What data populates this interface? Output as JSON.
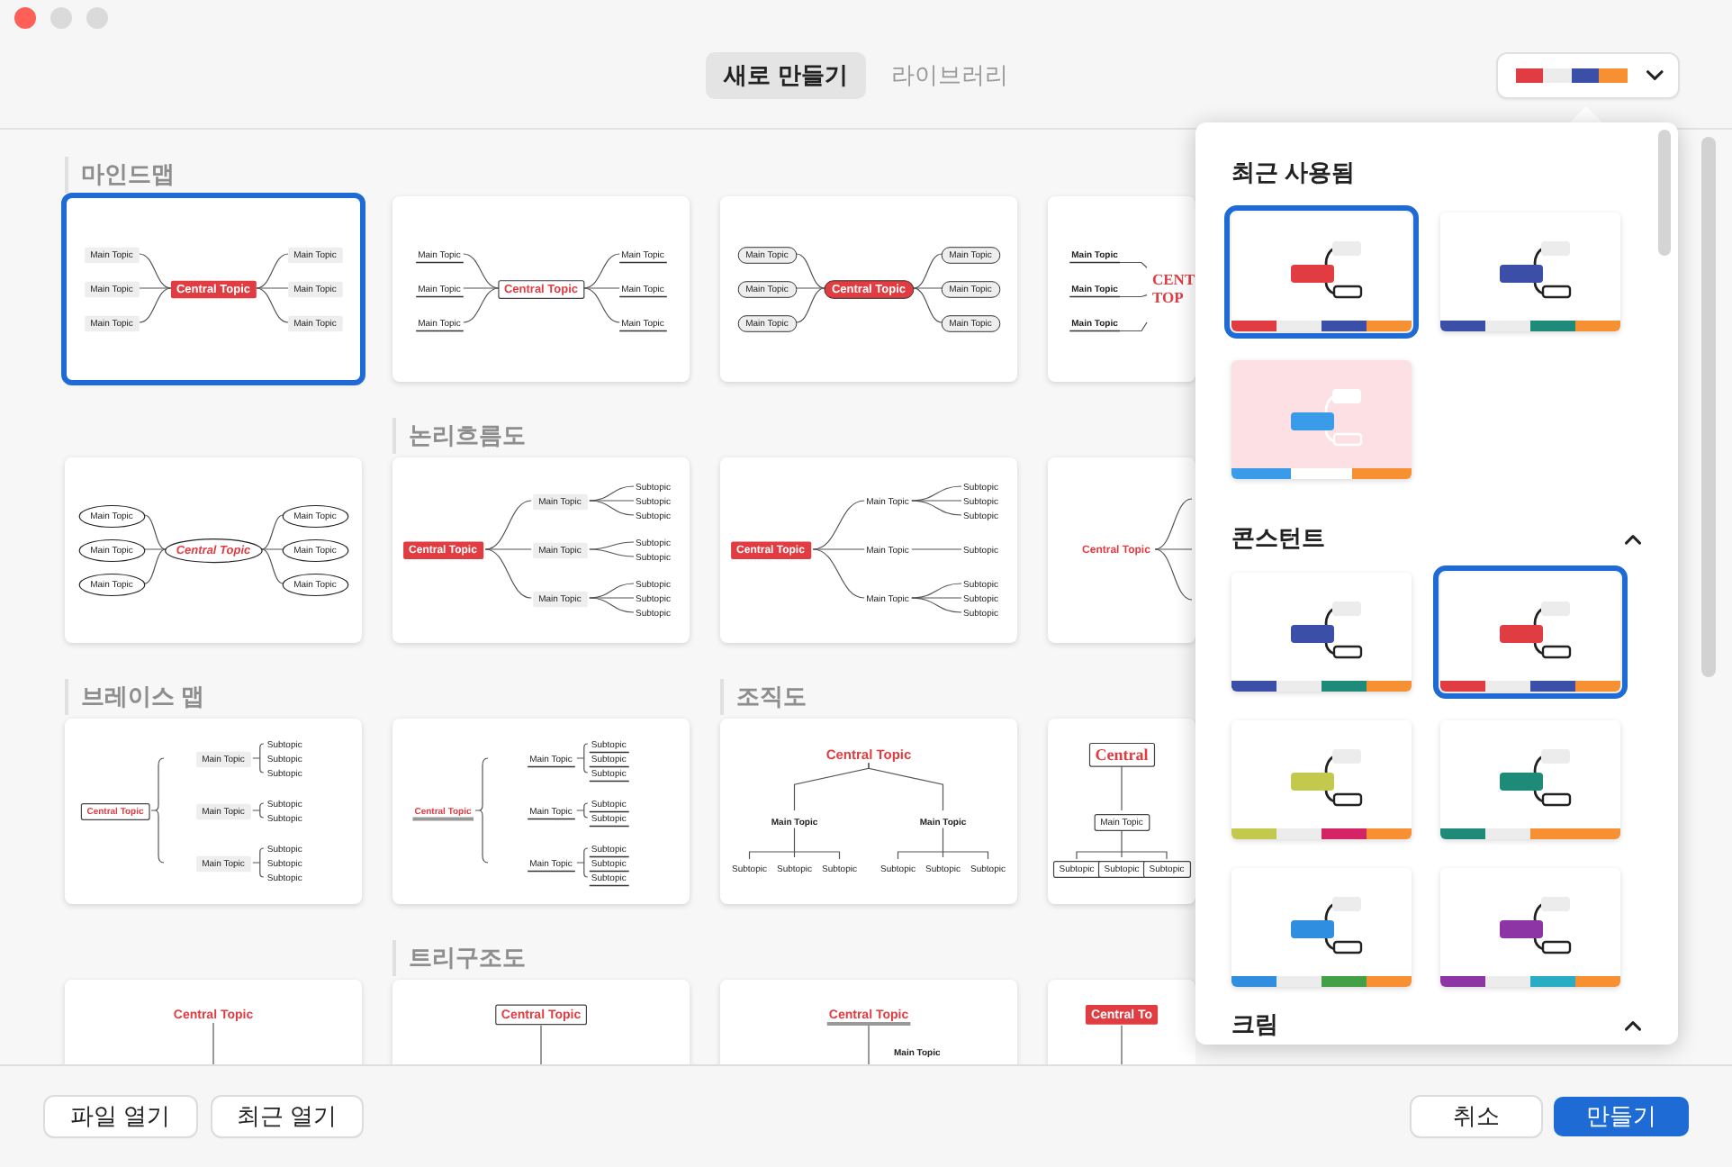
{
  "window": {
    "tabs": [
      {
        "label": "새로 만들기",
        "selected": true
      },
      {
        "label": "라이브러리",
        "selected": false
      }
    ],
    "theme_button": {
      "colors": [
        {
          "color": "#e03c41"
        },
        {
          "color": "#ececec"
        },
        {
          "color": "#3b4fa8"
        },
        {
          "color": "#f78f33"
        }
      ]
    }
  },
  "templates": [
    {
      "section": "마인드맵",
      "selected": true,
      "diagram": {
        "kind": "mindmap",
        "central": {
          "label": "Central Topic",
          "kind": "filled"
        },
        "branches": [
          {
            "label": "Main Topic",
            "kind": "filled"
          },
          {
            "label": "Main Topic",
            "kind": "filled"
          },
          {
            "label": "Main Topic",
            "kind": "filled"
          },
          {
            "label": "Main Topic",
            "kind": "filled"
          },
          {
            "label": "Main Topic",
            "kind": "filled"
          },
          {
            "label": "Main Topic",
            "kind": "filled"
          }
        ]
      }
    },
    {
      "selected": false,
      "diagram": {
        "kind": "mindmap",
        "central": {
          "label": "Central Topic",
          "kind": "outline"
        },
        "branches": [
          {
            "label": "Main Topic",
            "kind": "underline"
          },
          {
            "label": "Main Topic",
            "kind": "underline"
          },
          {
            "label": "Main Topic",
            "kind": "underline"
          },
          {
            "label": "Main Topic",
            "kind": "underline"
          },
          {
            "label": "Main Topic",
            "kind": "underline"
          },
          {
            "label": "Main Topic",
            "kind": "underline"
          }
        ]
      }
    },
    {
      "selected": false,
      "diagram": {
        "kind": "mindmap",
        "central": {
          "label": "Central Topic",
          "kind": "pill"
        },
        "branches": [
          {
            "label": "Main Topic",
            "kind": "pill"
          },
          {
            "label": "Main Topic",
            "kind": "pill"
          },
          {
            "label": "Main Topic",
            "kind": "pill"
          },
          {
            "label": "Main Topic",
            "kind": "pill"
          },
          {
            "label": "Main Topic",
            "kind": "pill"
          },
          {
            "label": "Main Topic",
            "kind": "pill"
          }
        ]
      }
    },
    {
      "selected": false,
      "diagram": {
        "kind": "map-left",
        "central": {
          "label": [
            "CENT",
            "TOP"
          ],
          "kind": "plain"
        },
        "branches": [
          {
            "label": "Main Topic",
            "kind": "underline"
          },
          {
            "label": "Main Topic",
            "kind": "underline"
          },
          {
            "label": "Main Topic",
            "kind": "underline"
          }
        ]
      }
    },
    {
      "selected": false,
      "diagram": {
        "kind": "mindmap",
        "central": {
          "label": "Central Topic",
          "kind": "ellipse"
        },
        "branches": [
          {
            "label": "Main Topic",
            "kind": "ellipse"
          },
          {
            "label": "Main Topic",
            "kind": "ellipse"
          },
          {
            "label": "Main Topic",
            "kind": "ellipse"
          },
          {
            "label": "Main Topic",
            "kind": "ellipse"
          },
          {
            "label": "Main Topic",
            "kind": "ellipse"
          },
          {
            "label": "Main Topic",
            "kind": "ellipse"
          }
        ]
      }
    },
    {
      "section": "논리흐름도",
      "selected": false,
      "diagram": {
        "kind": "logic",
        "central": {
          "label": "Central Topic",
          "kind": "filled"
        },
        "branches": [
          {
            "label": "Main Topic",
            "kind": "filled",
            "subtopics": [
              {
                "label": "Subtopic",
                "kind": "plain"
              },
              {
                "label": "Subtopic",
                "kind": "plain"
              },
              {
                "label": "Subtopic",
                "kind": "plain"
              }
            ]
          },
          {
            "label": "Main Topic",
            "kind": "filled",
            "subtopics": [
              {
                "label": "Subtopic",
                "kind": "plain"
              },
              {
                "label": "Subtopic",
                "kind": "plain"
              }
            ]
          },
          {
            "label": "Main Topic",
            "kind": "filled",
            "subtopics": [
              {
                "label": "Subtopic",
                "kind": "plain"
              },
              {
                "label": "Subtopic",
                "kind": "plain"
              },
              {
                "label": "Subtopic",
                "kind": "plain"
              }
            ]
          }
        ]
      }
    },
    {
      "selected": false,
      "diagram": {
        "kind": "logic",
        "central": {
          "label": "Central Topic",
          "kind": "filled"
        },
        "branches": [
          {
            "label": "Main Topic",
            "kind": "plain",
            "subtopics": [
              {
                "label": "Subtopic",
                "kind": "plain"
              },
              {
                "label": "Subtopic",
                "kind": "plain"
              },
              {
                "label": "Subtopic",
                "kind": "plain"
              }
            ]
          },
          {
            "label": "Main Topic",
            "kind": "plain",
            "subtopics": [
              {
                "label": "Subtopic",
                "kind": "plain"
              }
            ]
          },
          {
            "label": "Main Topic",
            "kind": "plain",
            "subtopics": [
              {
                "label": "Subtopic",
                "kind": "plain"
              },
              {
                "label": "Subtopic",
                "kind": "plain"
              },
              {
                "label": "Subtopic",
                "kind": "plain"
              }
            ]
          }
        ]
      }
    },
    {
      "selected": false,
      "diagram": {
        "kind": "logic",
        "central": {
          "label": "Central Topic",
          "kind": "plain"
        }
      }
    },
    {
      "section": "브레이스 맵",
      "selected": false,
      "diagram": {
        "kind": "brace",
        "central": {
          "label": "Central Topic",
          "kind": "outline"
        },
        "branches": [
          {
            "label": "Main Topic",
            "kind": "filled",
            "subtopics": [
              {
                "label": "Subtopic",
                "kind": "plain"
              },
              {
                "label": "Subtopic",
                "kind": "plain"
              },
              {
                "label": "Subtopic",
                "kind": "plain"
              }
            ]
          },
          {
            "label": "Main Topic",
            "kind": "filled",
            "subtopics": [
              {
                "label": "Subtopic",
                "kind": "plain"
              },
              {
                "label": "Subtopic",
                "kind": "plain"
              }
            ]
          },
          {
            "label": "Main Topic",
            "kind": "filled",
            "subtopics": [
              {
                "label": "Subtopic",
                "kind": "plain"
              },
              {
                "label": "Subtopic",
                "kind": "plain"
              },
              {
                "label": "Subtopic",
                "kind": "plain"
              }
            ]
          }
        ]
      }
    },
    {
      "selected": false,
      "diagram": {
        "kind": "brace",
        "central": {
          "label": "Central Topic",
          "kind": "underline"
        },
        "branches": [
          {
            "label": "Main Topic",
            "kind": "underline",
            "subtopics": [
              {
                "label": "Subtopic",
                "kind": "underline"
              },
              {
                "label": "Subtopic",
                "kind": "underline"
              },
              {
                "label": "Subtopic",
                "kind": "underline"
              }
            ]
          },
          {
            "label": "Main Topic",
            "kind": "underline",
            "subtopics": [
              {
                "label": "Subtopic",
                "kind": "underline"
              },
              {
                "label": "Subtopic",
                "kind": "underline"
              }
            ]
          },
          {
            "label": "Main Topic",
            "kind": "underline",
            "subtopics": [
              {
                "label": "Subtopic",
                "kind": "underline"
              },
              {
                "label": "Subtopic",
                "kind": "underline"
              },
              {
                "label": "Subtopic",
                "kind": "underline"
              }
            ]
          }
        ]
      }
    },
    {
      "section": "조직도",
      "selected": false,
      "diagram": {
        "kind": "org",
        "central": {
          "label": "Central Topic",
          "kind": "plain"
        },
        "branches": [
          {
            "label": "Main Topic",
            "kind": "plain",
            "subtopics": [
              {
                "label": "Subtopic",
                "kind": "plain"
              },
              {
                "label": "Subtopic",
                "kind": "plain"
              },
              {
                "label": "Subtopic",
                "kind": "plain"
              }
            ]
          },
          {
            "label": "Main Topic",
            "kind": "plain",
            "subtopics": [
              {
                "label": "Subtopic",
                "kind": "plain"
              },
              {
                "label": "Subtopic",
                "kind": "plain"
              },
              {
                "label": "Subtopic",
                "kind": "plain"
              }
            ]
          }
        ]
      }
    },
    {
      "selected": false,
      "diagram": {
        "kind": "org",
        "central": {
          "label": "Central",
          "kind": "outline"
        },
        "branches": [
          {
            "label": "Main Topic",
            "kind": "outline",
            "subtopics": [
              {
                "label": "Subtopic",
                "kind": "outline"
              },
              {
                "label": "Subtopic",
                "kind": "outline"
              },
              {
                "label": "Subtopic",
                "kind": "outline"
              }
            ]
          }
        ]
      }
    },
    {
      "selected": false,
      "diagram": {
        "kind": "tree",
        "central": {
          "label": "Central Topic",
          "kind": "plain"
        }
      }
    },
    {
      "section": "트리구조도",
      "selected": false,
      "diagram": {
        "kind": "tree",
        "central": {
          "label": "Central Topic",
          "kind": "outline"
        }
      }
    },
    {
      "selected": false,
      "diagram": {
        "kind": "tree",
        "central": {
          "label": "Central Topic",
          "kind": "underline"
        },
        "branches": [
          {
            "label": "Main Topic",
            "kind": "plain"
          }
        ]
      }
    },
    {
      "selected": false,
      "diagram": {
        "kind": "tree",
        "central": {
          "label": "Central To",
          "kind": "filled"
        }
      }
    }
  ],
  "theme_popup": {
    "sections": [
      {
        "title": "최근 사용됨",
        "themes": [
          {
            "selected": true,
            "color": "#ffffff",
            "colors": [
              {
                "color": "#e03c41"
              },
              {
                "color": "#ececec"
              },
              {
                "color": "#3b4fa8"
              },
              {
                "color": "#f78f33"
              }
            ]
          },
          {
            "selected": false,
            "color": "#ffffff",
            "colors": [
              {
                "color": "#3b4fa8"
              },
              {
                "color": "#ececec"
              },
              {
                "color": "#1e8a78"
              },
              {
                "color": "#f78f33"
              }
            ]
          },
          {
            "selected": false,
            "color": "#fde0e4",
            "colors": [
              {
                "color": "#3a9be8"
              },
              {
                "color": "#ffffff"
              },
              {
                "color": "#f78f33"
              }
            ]
          }
        ]
      },
      {
        "title": "콘스턴트",
        "expanded": true,
        "themes": [
          {
            "selected": false,
            "color": "#ffffff",
            "colors": [
              {
                "color": "#3b4fa8"
              },
              {
                "color": "#ececec"
              },
              {
                "color": "#1e8a78"
              },
              {
                "color": "#f78f33"
              }
            ]
          },
          {
            "selected": true,
            "color": "#ffffff",
            "colors": [
              {
                "color": "#e03c41"
              },
              {
                "color": "#ececec"
              },
              {
                "color": "#3b4fa8"
              },
              {
                "color": "#f78f33"
              }
            ]
          },
          {
            "selected": false,
            "color": "#ffffff",
            "colors": [
              {
                "color": "#c2c94d"
              },
              {
                "color": "#ececec"
              },
              {
                "color": "#d42466"
              },
              {
                "color": "#f78f33"
              }
            ]
          },
          {
            "selected": false,
            "color": "#ffffff",
            "colors": [
              {
                "color": "#1e8a78"
              },
              {
                "color": "#ececec"
              },
              {
                "color": "#f78f33"
              },
              {
                "color": "#f78f33"
              }
            ]
          },
          {
            "selected": false,
            "color": "#ffffff",
            "colors": [
              {
                "color": "#2f8ee0"
              },
              {
                "color": "#ececec"
              },
              {
                "color": "#43a047"
              },
              {
                "color": "#f78f33"
              }
            ]
          },
          {
            "selected": false,
            "color": "#ffffff",
            "colors": [
              {
                "color": "#8e35a6"
              },
              {
                "color": "#ececec"
              },
              {
                "color": "#29adc4"
              },
              {
                "color": "#f78f33"
              }
            ]
          }
        ]
      },
      {
        "title": "크림",
        "expanded": true
      }
    ]
  },
  "footer": {
    "left_buttons": [
      {
        "label": "파일 열기",
        "kind": "default"
      },
      {
        "label": "최근 열기",
        "kind": "default"
      }
    ],
    "right_buttons": [
      {
        "label": "취소",
        "kind": "default"
      },
      {
        "label": "만들기",
        "kind": "primary"
      }
    ]
  }
}
